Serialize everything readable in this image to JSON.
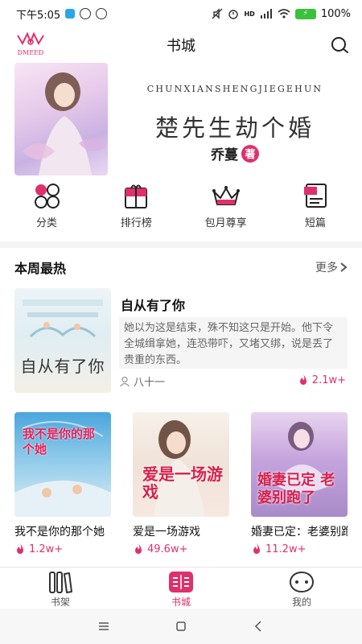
{
  "status_bar": {
    "time": "下午5:05",
    "battery_label": "100%",
    "battery_level": 1.0,
    "network": "HD"
  },
  "header": {
    "logo_text": "DMEED",
    "title": "书城"
  },
  "banner": {
    "pinyin": "CHUNXIANSHENGJIEGEHUN",
    "title": "楚先生劫个婚",
    "author": "乔蔓",
    "badge": "著"
  },
  "quick_nav": [
    {
      "label": "分类",
      "icon": "category-icon"
    },
    {
      "label": "排行榜",
      "icon": "ranking-icon"
    },
    {
      "label": "包月尊享",
      "icon": "crown-icon"
    },
    {
      "label": "短篇",
      "icon": "short-story-icon"
    }
  ],
  "section": {
    "title": "本周最热",
    "more": "更多"
  },
  "featured": {
    "title": "自从有了你",
    "cover_text": "自从有了你",
    "description": "她以为这是结束，殊不知这只是开始。他下令全城缉拿她，连恐带吓，又堵又绑，说是丢了贵重的东西。",
    "author": "八十一",
    "heat": "2.1w+"
  },
  "books": [
    {
      "title": "我不是你的那个她",
      "cover_text": "我不是你的那个她",
      "heat": "1.2w+"
    },
    {
      "title": "爱是一场游戏",
      "cover_text": "爱是一场游戏",
      "heat": "49.6w+"
    },
    {
      "title": "婚妻已定：老婆别跑了",
      "cover_text": "婚妻已定 老婆别跑了",
      "heat": "11.2w+"
    }
  ],
  "tabs": [
    {
      "label": "书架",
      "active": false
    },
    {
      "label": "书城",
      "active": true
    },
    {
      "label": "我的",
      "active": false
    }
  ],
  "colors": {
    "accent": "#e0306c",
    "status_battery": "#3cc13c"
  }
}
